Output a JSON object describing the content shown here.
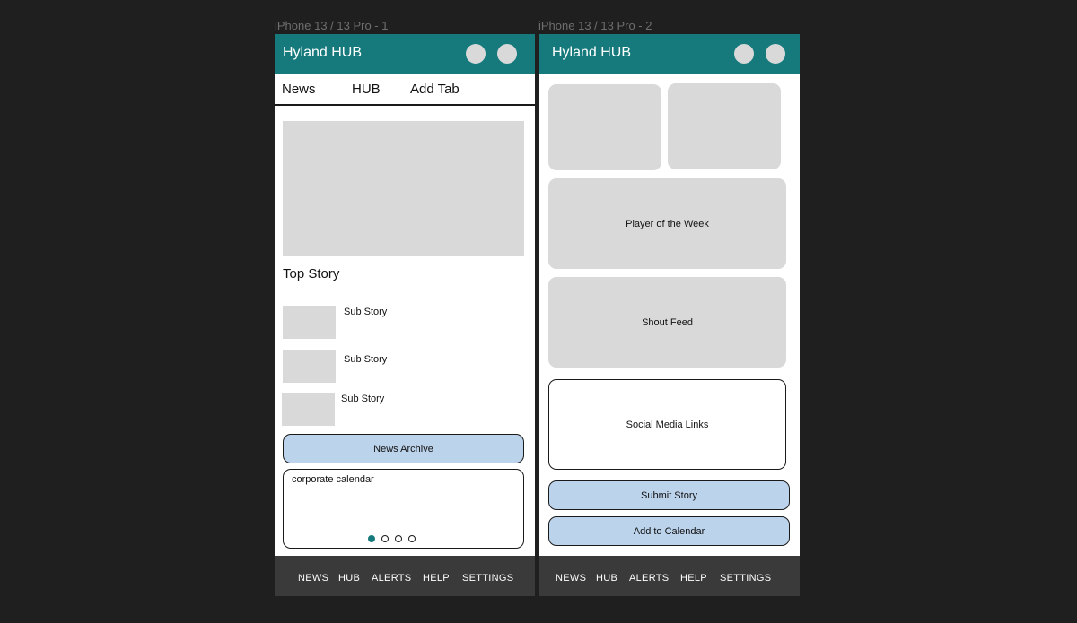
{
  "frames": [
    {
      "label": "iPhone 13 / 13 Pro - 1",
      "app_title": "Hyland HUB",
      "tabs": [
        "News",
        "HUB",
        "Add Tab"
      ],
      "top_story_label": "Top Story",
      "sub_stories": [
        "Sub Story",
        "Sub Story",
        "Sub Story"
      ],
      "archive_button": "News Archive",
      "calendar_label": "corporate calendar",
      "carousel": {
        "total": 4,
        "active": 1
      },
      "nav": [
        "NEWS",
        "HUB",
        "ALERTS",
        "HELP",
        "SETTINGS"
      ]
    },
    {
      "label": "iPhone 13 / 13 Pro - 2",
      "app_title": "Hyland HUB",
      "player_card": "Player of the Week",
      "shout_card": "Shout Feed",
      "social_card": "Social Media Links",
      "submit_button": "Submit Story",
      "calendar_button": "Add to Calendar",
      "nav": [
        "NEWS",
        "HUB",
        "ALERTS",
        "HELP",
        "SETTINGS"
      ]
    }
  ],
  "colors": {
    "canvas": "#1f1f1f",
    "appbar": "#167a7c",
    "placeholder": "#d9d9d9",
    "button_fill": "#bcd3ec",
    "bottom_nav": "#3a3a3a"
  },
  "icons": {
    "avatar": "avatar-circle-icon"
  }
}
